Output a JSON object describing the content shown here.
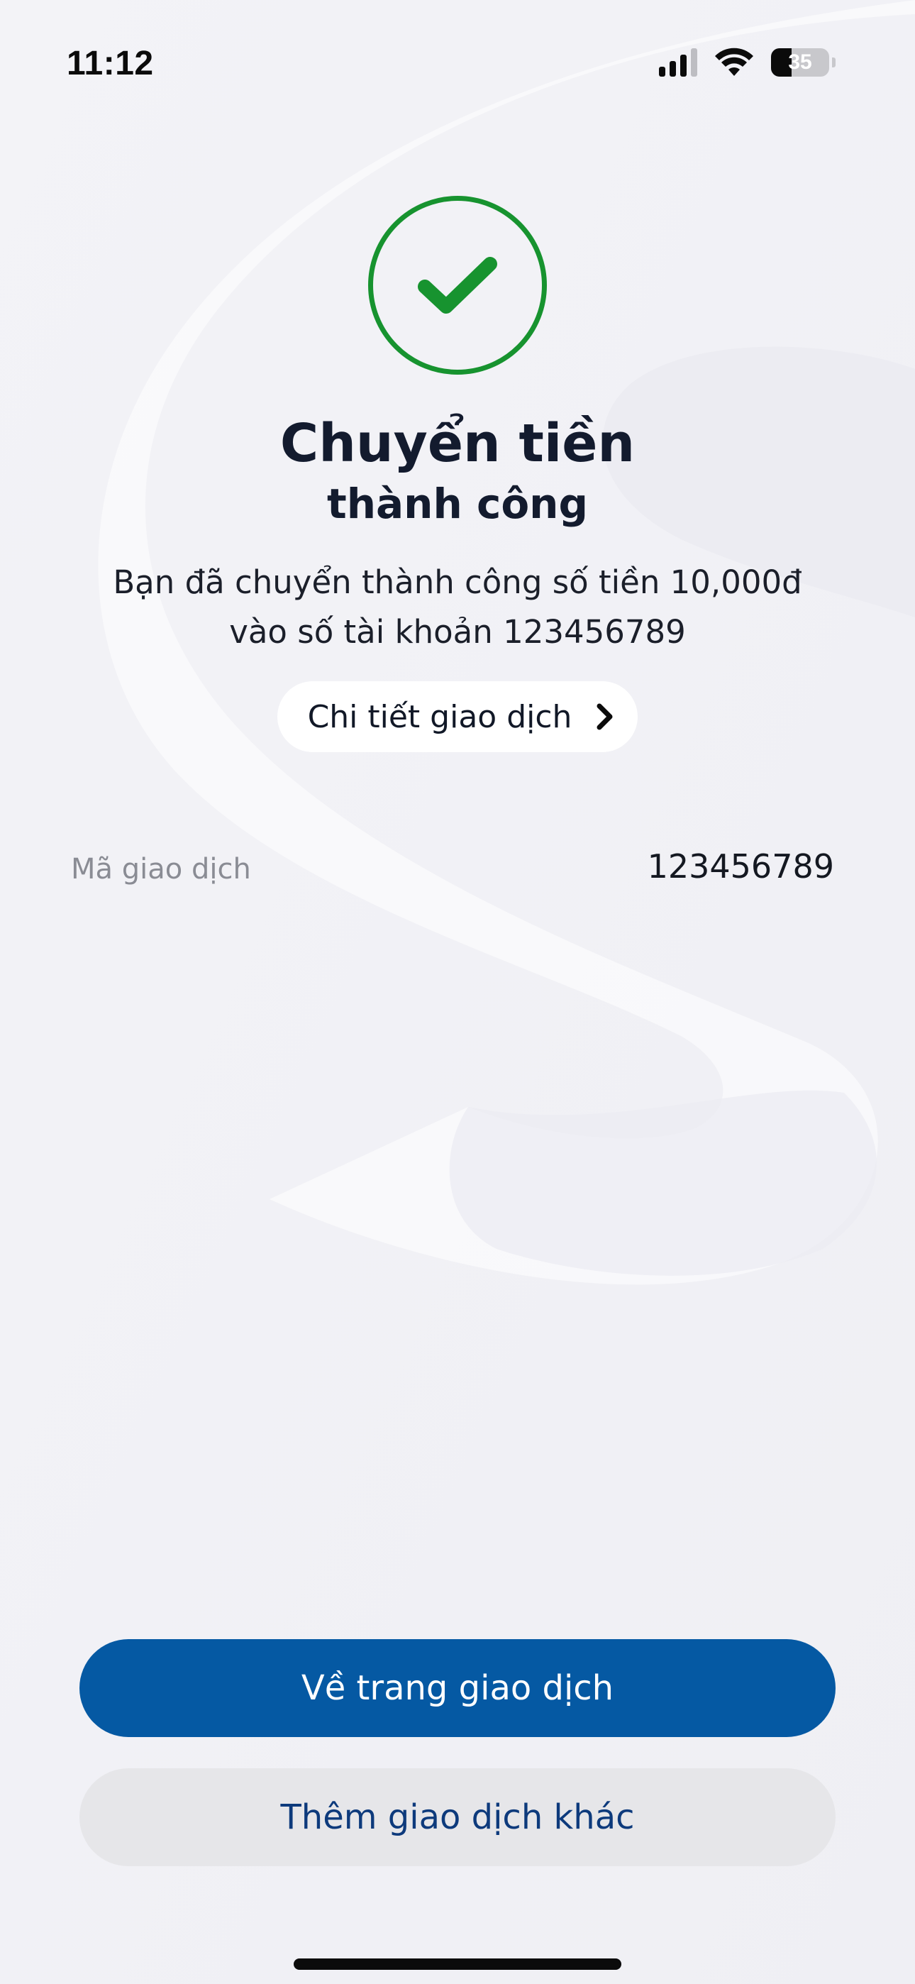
{
  "status_bar": {
    "time": "11:12",
    "battery_level": "35",
    "signal_bars": 3,
    "icons": [
      "signal-icon",
      "wifi-icon",
      "battery-icon"
    ]
  },
  "result": {
    "icon": "check-icon",
    "status_color": "#17932f",
    "title": "Chuyển tiền",
    "subtitle": "thành công",
    "message_line1": "Bạn đã chuyển thành công số tiền 10,000đ",
    "message_line2": "vào số tài khoản 123456789"
  },
  "detail_link": {
    "label": "Chi tiết giao dịch",
    "icon": "chevron-right-icon"
  },
  "transaction": {
    "id_label": "Mã giao dịch",
    "id_value": "123456789"
  },
  "actions": {
    "primary_label": "Về trang giao dịch",
    "primary_color": "#0559a3",
    "secondary_label": "Thêm giao dịch khác",
    "secondary_color": "#e6e6e9"
  }
}
